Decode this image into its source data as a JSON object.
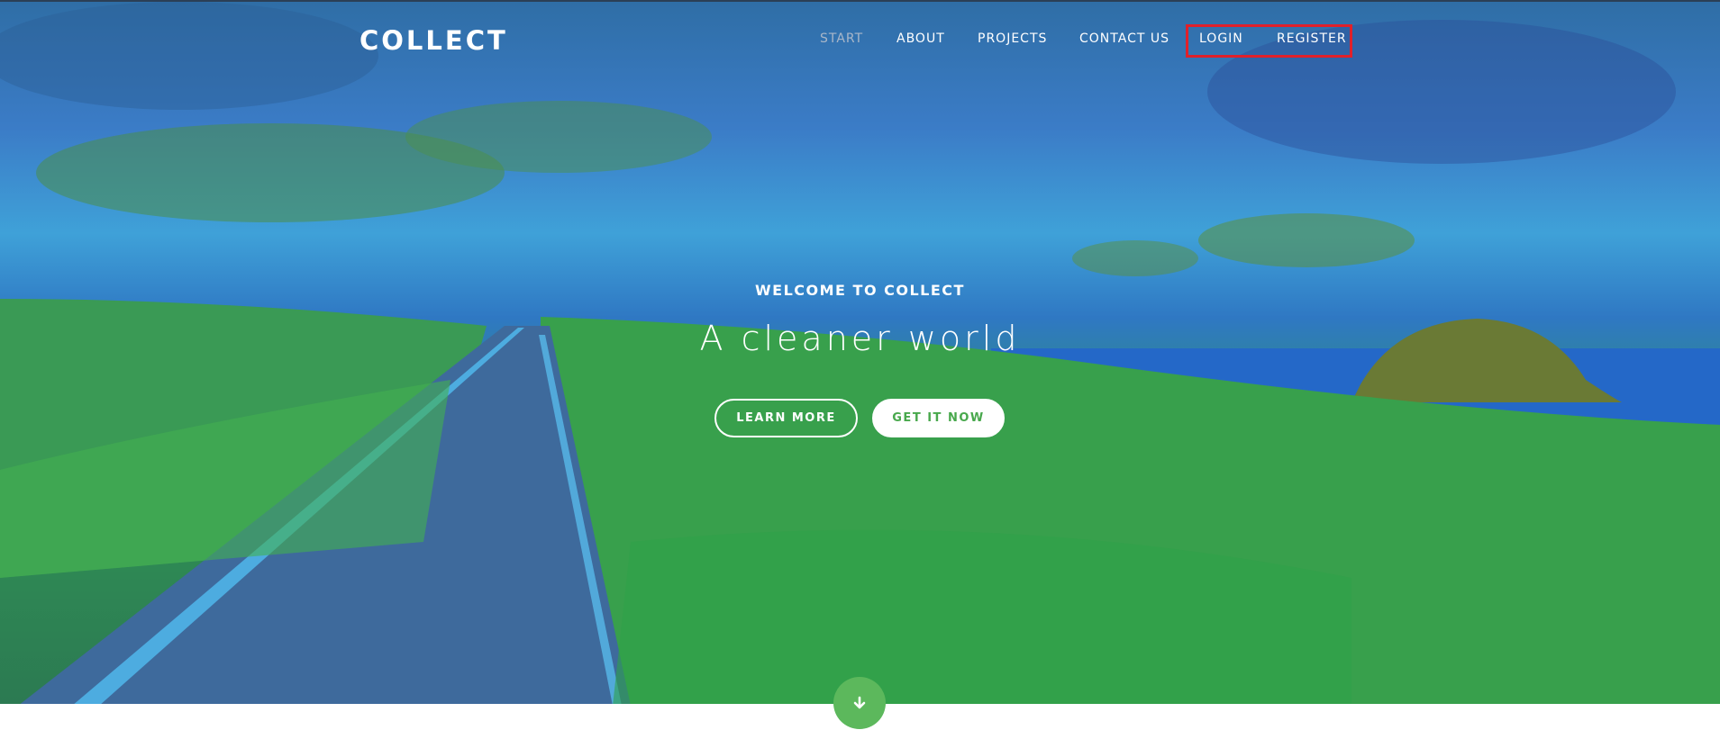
{
  "brand": {
    "name": "COLLECT"
  },
  "nav": {
    "items": [
      {
        "label": "START",
        "active": true
      },
      {
        "label": "ABOUT",
        "active": false
      },
      {
        "label": "PROJECTS",
        "active": false
      },
      {
        "label": "CONTACT US",
        "active": false
      },
      {
        "label": "LOGIN",
        "active": false
      },
      {
        "label": "REGISTER",
        "active": false
      }
    ]
  },
  "hero": {
    "eyebrow": "WELCOME TO COLLECT",
    "headline": "A cleaner world",
    "buttons": {
      "learn_more": "LEARN MORE",
      "get_it_now": "GET IT NOW"
    }
  },
  "icons": {
    "scroll_down": "arrow-down-icon"
  },
  "colors": {
    "accent_green": "#5cb85c",
    "highlight_red": "#e0202a",
    "nav_active": "#a9b7c9"
  }
}
